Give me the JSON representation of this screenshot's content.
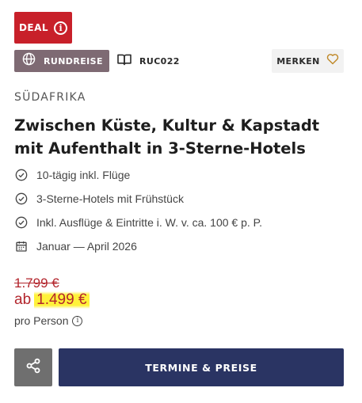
{
  "badges": {
    "deal_label": "DEAL",
    "trip_type_label": "RUNDREISE",
    "trip_code": "RUC022",
    "save_label": "MERKEN"
  },
  "offer": {
    "region": "SÜDAFRIKA",
    "title": "Zwischen Küste, Kultur & Kapstadt mit Aufenthalt in 3-Sterne-Hotels",
    "features": [
      {
        "icon": "check-circle-icon",
        "text": "10-tägig inkl. Flüge"
      },
      {
        "icon": "check-circle-icon",
        "text": "3-Sterne-Hotels mit Frühstück"
      },
      {
        "icon": "check-circle-icon",
        "text": "Inkl. Ausflüge & Eintritte i. W. v. ca. 100 € p. P."
      },
      {
        "icon": "calendar-icon",
        "text": "Januar — April 2026"
      }
    ]
  },
  "price": {
    "old": "1.799 €",
    "prefix": "ab",
    "current": "1.499 €",
    "per_person": "pro Person"
  },
  "actions": {
    "cta_label": "TERMINE & PREISE"
  },
  "colors": {
    "deal_red": "#c8202a",
    "trip_type_bg": "#7e6a73",
    "price_red": "#b3262d",
    "highlight_yellow": "#fff23a",
    "cta_navy": "#2a3463",
    "share_gray": "#6f6f6f"
  }
}
